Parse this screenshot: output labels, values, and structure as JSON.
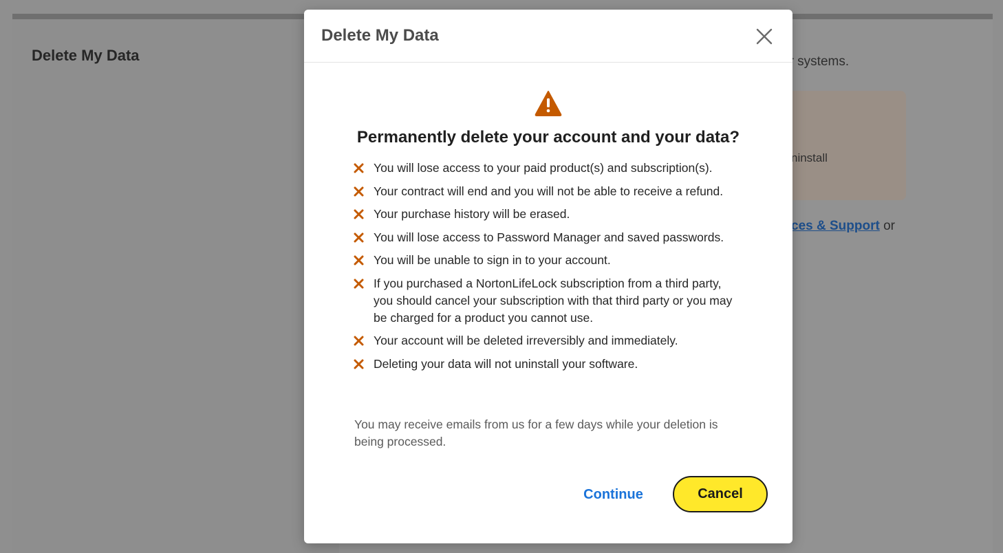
{
  "background": {
    "title": "Delete My Data",
    "text_systems": "ur systems.",
    "text_uninstall": "ninstall",
    "link_text": "ces & Support",
    "link_suffix": " or"
  },
  "modal": {
    "title": "Delete My Data",
    "close_icon": "close-icon",
    "warning_icon": "warning-triangle-icon",
    "headline": "Permanently delete your account and your data?",
    "items": [
      "You will lose access to your paid product(s) and subscription(s).",
      "Your contract will end and you will not be able to receive a refund.",
      "Your purchase history will be erased.",
      "You will lose access to Password Manager and saved passwords.",
      "You will be unable to sign in to your account.",
      "If you purchased a NortonLifeLock subscription from a third party, you should cancel your subscription with that third party or you may be charged for a product you cannot use.",
      "Your account will be deleted irreversibly and immediately.",
      "Deleting your data will not uninstall your software."
    ],
    "note": "You may receive emails from us for a few days while your deletion is being processed.",
    "continue_label": "Continue",
    "cancel_label": "Cancel"
  },
  "colors": {
    "accent_yellow": "#ffe82a",
    "warning_orange": "#c45a00",
    "link_blue": "#1a73d9",
    "overlay": "#8f8f8f"
  }
}
